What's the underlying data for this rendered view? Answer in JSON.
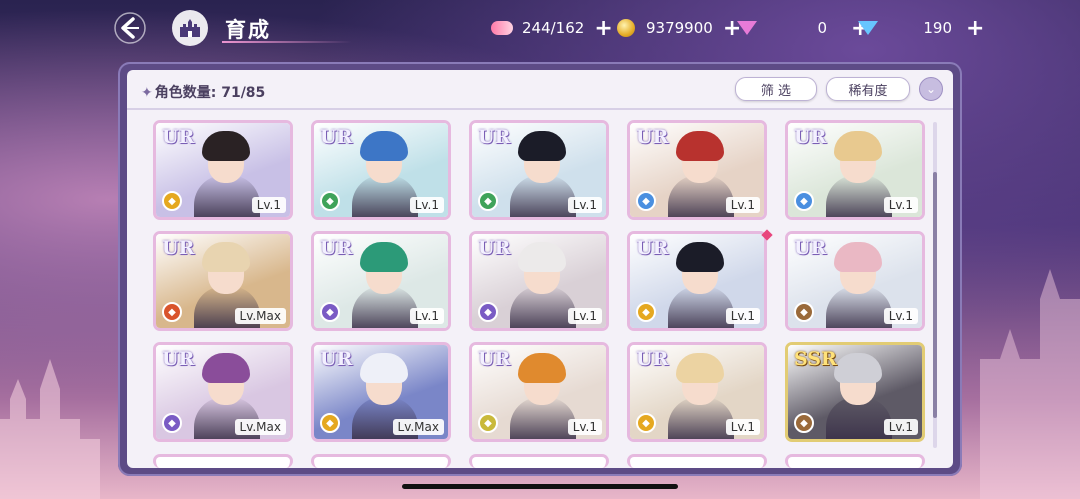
{
  "header": {
    "title": "育成",
    "resources": [
      {
        "name": "candy",
        "value": "244/162"
      },
      {
        "name": "coin",
        "value": "9379900"
      },
      {
        "name": "pink-gem",
        "value": "0"
      },
      {
        "name": "blue-gem",
        "value": "190"
      }
    ],
    "plus": "+"
  },
  "panel": {
    "count_label": "角色数量: 71/85",
    "filter_label": "筛 选",
    "rarity_label": "稀有度"
  },
  "cards": [
    {
      "rarity": "UR",
      "level": "Lv.1",
      "attr_color": "#e5a820",
      "hair": "#2a2224",
      "bg": "#c8c0e6"
    },
    {
      "rarity": "UR",
      "level": "Lv.1",
      "attr_color": "#3fa35a",
      "hair": "#3d76c6",
      "bg": "#bfe0e8"
    },
    {
      "rarity": "UR",
      "level": "Lv.1",
      "attr_color": "#3fa35a",
      "hair": "#1b1c28",
      "bg": "#cfe0ec"
    },
    {
      "rarity": "UR",
      "level": "Lv.1",
      "attr_color": "#4a8fe0",
      "hair": "#b8322e",
      "bg": "#e6d3c6"
    },
    {
      "rarity": "UR",
      "level": "Lv.1",
      "attr_color": "#4a8fe0",
      "hair": "#e8c98f",
      "bg": "#dbe6d9"
    },
    {
      "rarity": "UR",
      "level": "Lv.Max",
      "attr_color": "#d9542c",
      "hair": "#e8d4b0",
      "bg": "#d8b78c"
    },
    {
      "rarity": "UR",
      "level": "Lv.1",
      "attr_color": "#7a5bc4",
      "hair": "#2c9a78",
      "bg": "#dde8e6"
    },
    {
      "rarity": "UR",
      "level": "Lv.1",
      "attr_color": "#7a5bc4",
      "hair": "#eceaea",
      "bg": "#d9d0d6"
    },
    {
      "rarity": "UR",
      "level": "Lv.1",
      "attr_color": "#e5a820",
      "hair": "#1b1c28",
      "bg": "#d0d8ea"
    },
    {
      "rarity": "UR",
      "level": "Lv.1",
      "attr_color": "#9a6a3a",
      "hair": "#eab8c4",
      "bg": "#dce2ec"
    },
    {
      "rarity": "UR",
      "level": "Lv.Max",
      "attr_color": "#7a5bc4",
      "hair": "#8a4d9a",
      "bg": "#d9c7e2"
    },
    {
      "rarity": "UR",
      "level": "Lv.Max",
      "attr_color": "#e5a820",
      "hair": "#eef0f8",
      "bg": "#7a86c8"
    },
    {
      "rarity": "UR",
      "level": "Lv.1",
      "attr_color": "#c9b93a",
      "hair": "#e08a2e",
      "bg": "#e6dad2"
    },
    {
      "rarity": "UR",
      "level": "Lv.1",
      "attr_color": "#e5a820",
      "hair": "#ecd3a2",
      "bg": "#e3d6c6"
    },
    {
      "rarity": "SSR",
      "level": "Lv.1",
      "attr_color": "#9a6a3a",
      "hair": "#cfcfd6",
      "bg": "#5e5a66"
    }
  ]
}
